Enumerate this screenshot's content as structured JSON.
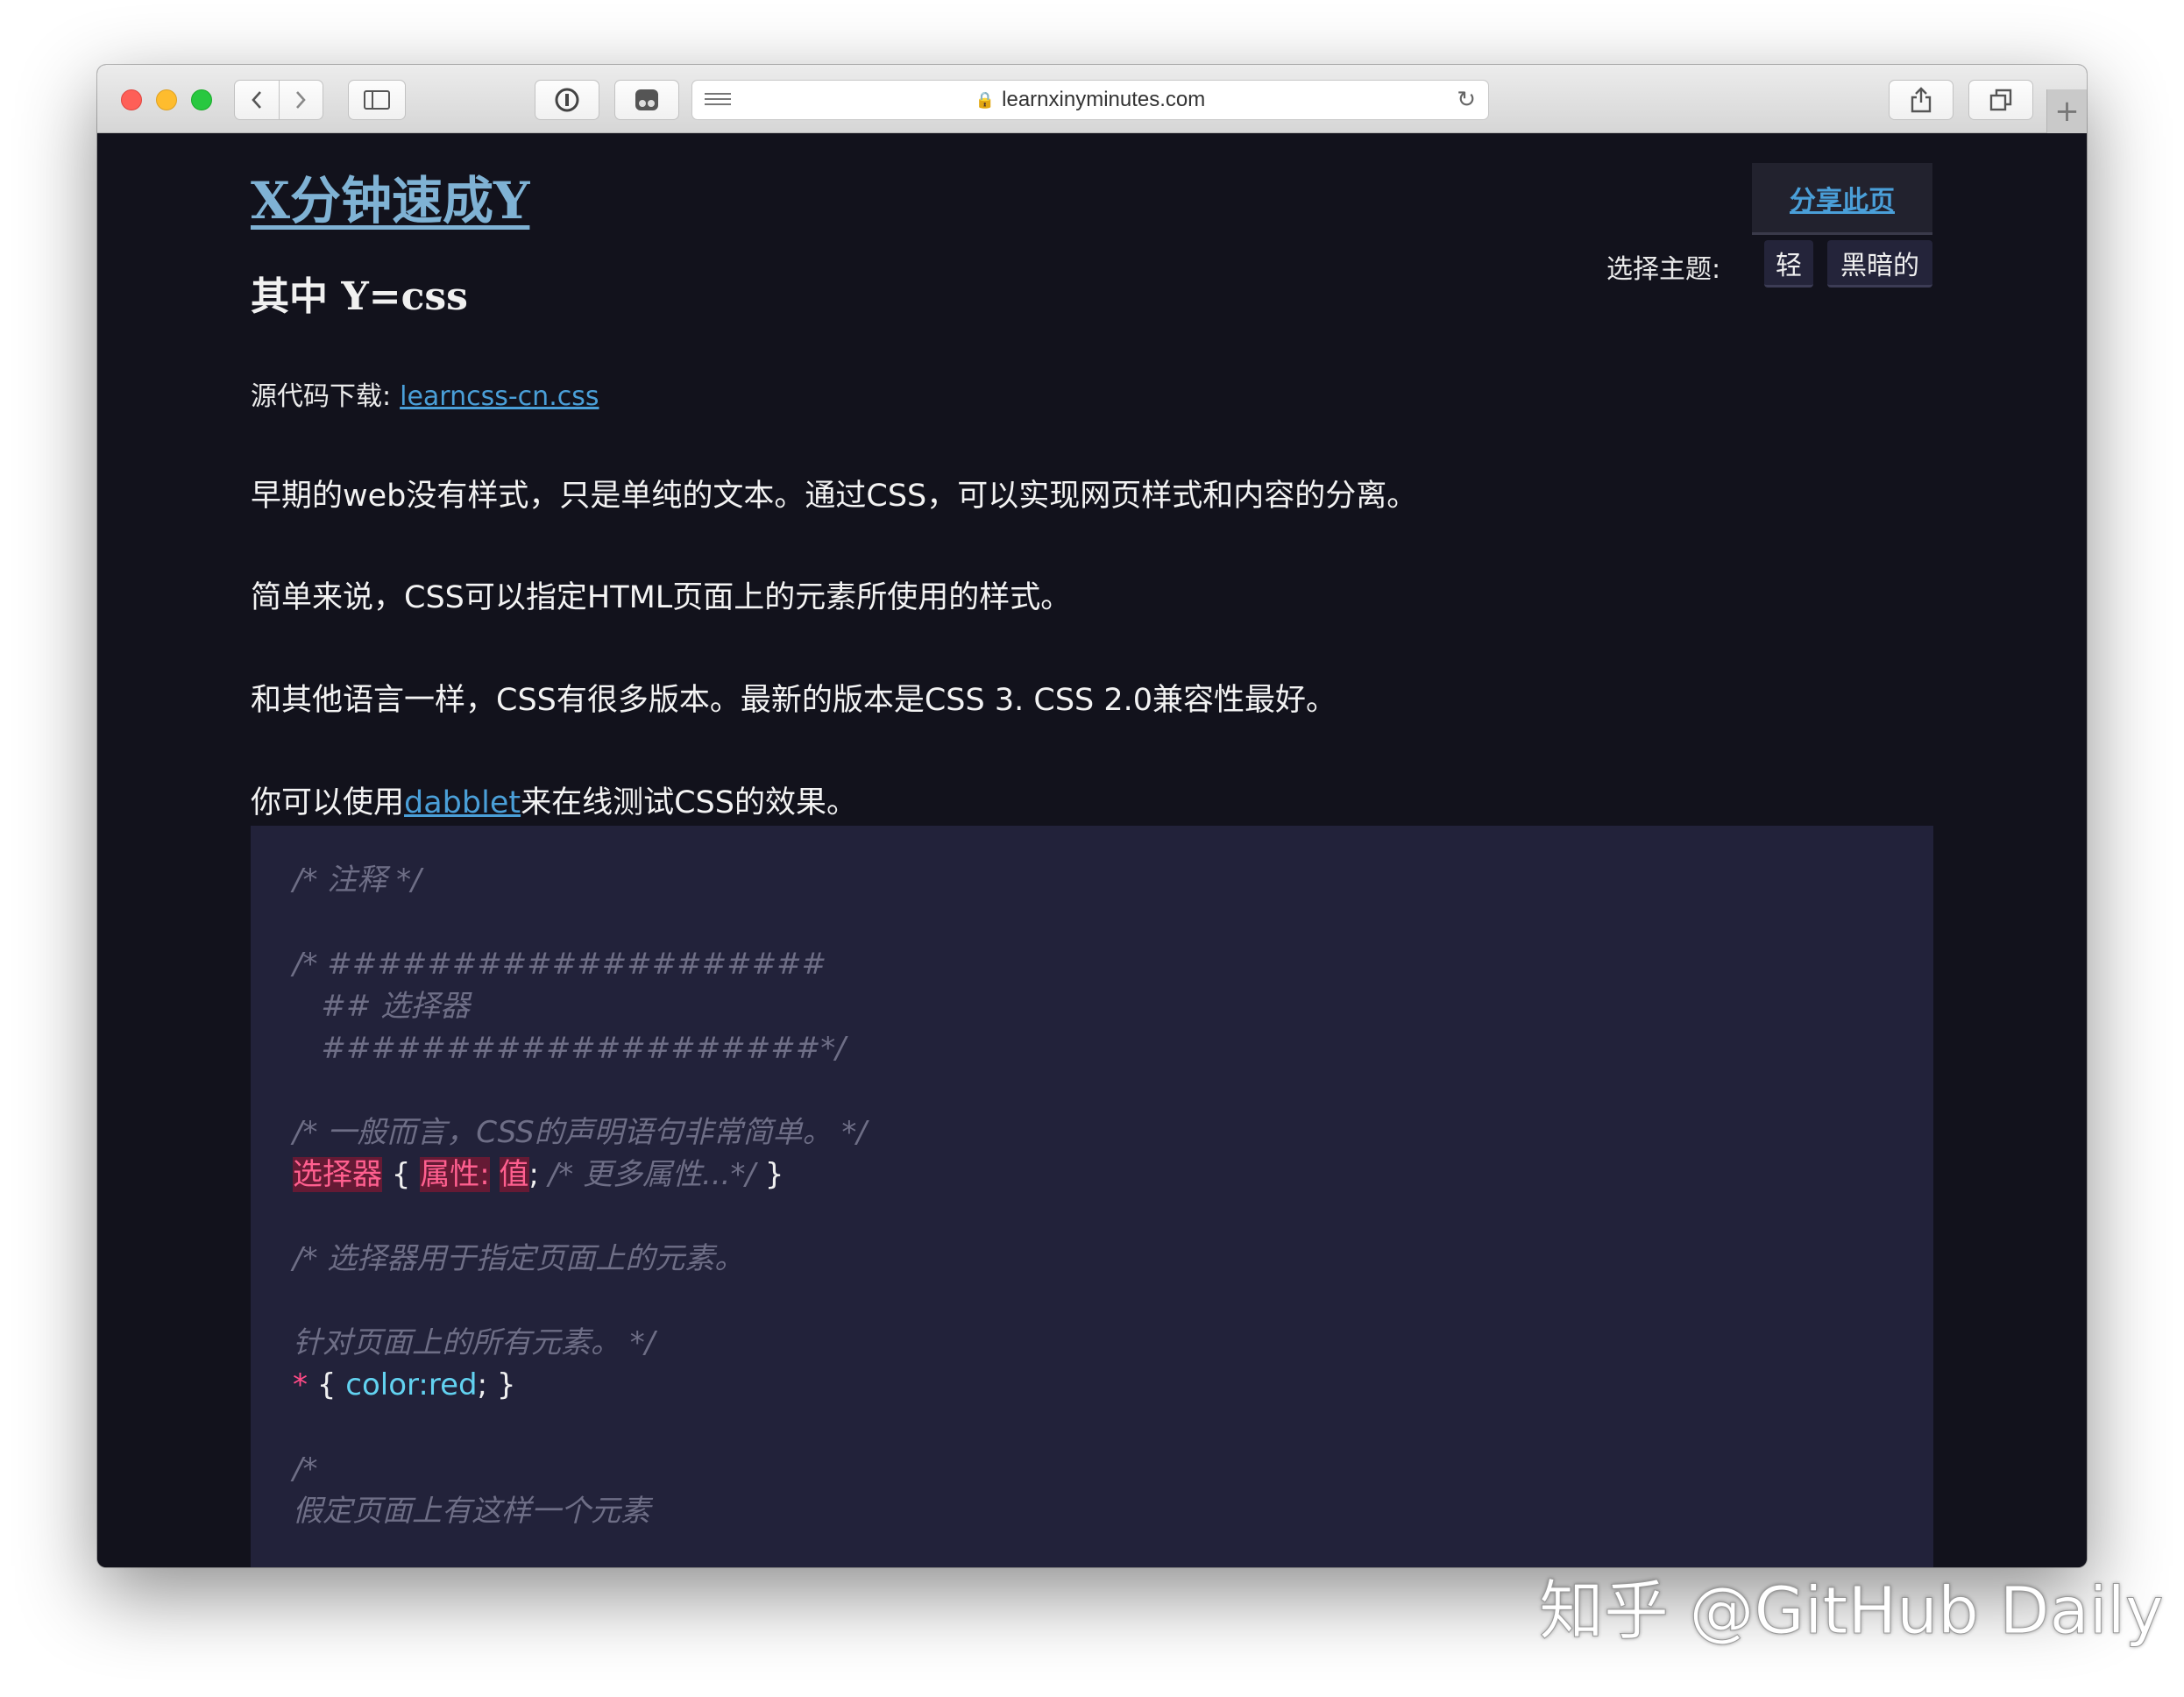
{
  "browser": {
    "url": "learnxinyminutes.com"
  },
  "header": {
    "site_title": "X分钟速成Y",
    "subtitle": "其中 Y=css",
    "share_label": "分享此页",
    "theme_label": "选择主题:",
    "theme_light": "轻",
    "theme_dark": "黑暗的"
  },
  "source": {
    "label": "源代码下载:",
    "link": "learncss-cn.css"
  },
  "paragraphs": {
    "p1": "早期的web没有样式，只是单纯的文本。通过CSS，可以实现网页样式和内容的分离。",
    "p2": "简单来说，CSS可以指定HTML页面上的元素所使用的样式。",
    "p3": "和其他语言一样，CSS有很多版本。最新的版本是CSS 3. CSS 2.0兼容性最好。",
    "p4_before": "你可以使用",
    "p4_link": "dabblet",
    "p4_after": "来在线测试CSS的效果。"
  },
  "code": {
    "l1": "/* 注释 */",
    "l3": "/* ####################",
    "l4": "   ## 选择器",
    "l5": "   ####################*/",
    "l7": "/* 一般而言，CSS的声明语句非常简单。 */",
    "l8_selector": "选择器",
    "l8_open": " { ",
    "l8_prop": "属性:",
    "l8_space": " ",
    "l8_value": "值",
    "l8_semi": "; ",
    "l8_comment": "/* 更多属性...*/",
    "l8_close": " }",
    "l10": "/* 选择器用于指定页面上的元素。",
    "l12": "针对页面上的所有元素。 */",
    "l13_star": "*",
    "l13_open": " { ",
    "l13_prop": "color",
    "l13_colon": ":",
    "l13_value": "red",
    "l13_close": "; }",
    "l15": "/*",
    "l16": "假定页面上有这样一个元素"
  },
  "watermark": "知乎 @GitHub Daily"
}
